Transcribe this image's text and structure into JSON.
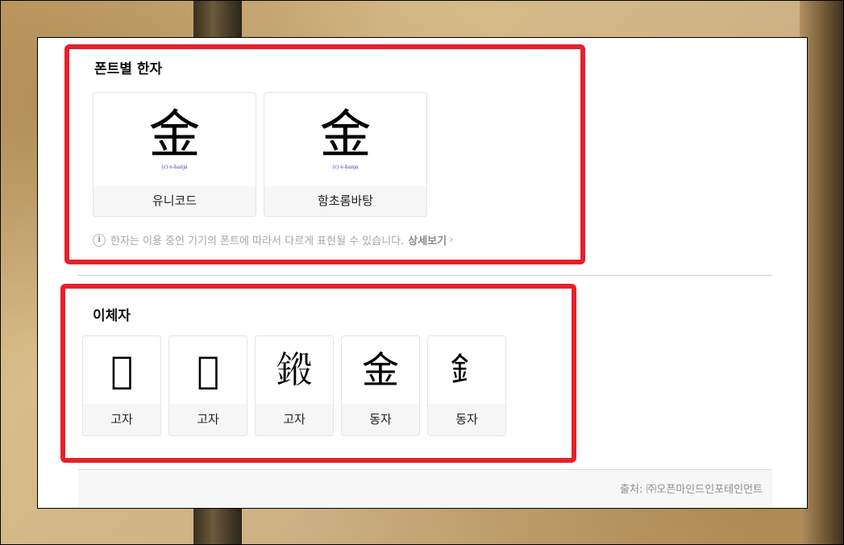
{
  "font_section": {
    "title": "폰트별 한자",
    "cards": [
      {
        "glyph": "金",
        "watermark": "(c) e-hanja",
        "label": "유니코드"
      },
      {
        "glyph": "金",
        "watermark": "(c) e-hanja",
        "label": "함초롬바탕"
      }
    ],
    "notice": {
      "text": "한자는 이용 중인 기기의 폰트에 따라서 다르게 표현될 수 있습니다.",
      "link": "상세보기"
    }
  },
  "variant_section": {
    "title": "이체자",
    "cards": [
      {
        "glyph": "𨥁",
        "label": "고자"
      },
      {
        "glyph": "𨦟",
        "label": "고자"
      },
      {
        "glyph": "𨦯",
        "label": "고자"
      },
      {
        "glyph": "金",
        "label": "동자"
      },
      {
        "glyph": "釒",
        "label": "동자"
      }
    ]
  },
  "footer": {
    "source": "출처: ㈜오픈마인드인포테인먼트"
  },
  "colors": {
    "highlight": "#e8202a",
    "caption_bg": "#f6f6f6"
  }
}
